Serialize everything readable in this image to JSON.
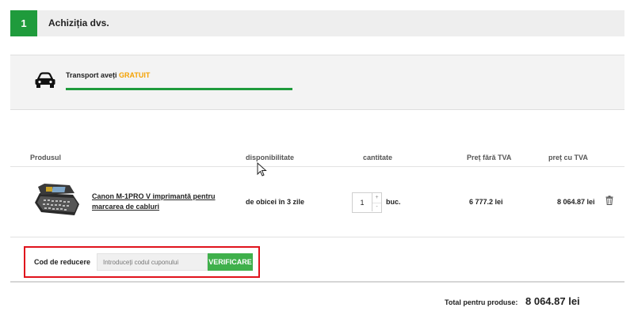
{
  "step": {
    "number": "1",
    "title": "Achiziția dvs."
  },
  "transport": {
    "text": "Transport aveți",
    "highlight": "GRATUIT",
    "progress": 1.0,
    "icon": "car-icon"
  },
  "table": {
    "headers": {
      "product": "Produsul",
      "availability": "disponibilitate",
      "quantity": "cantitate",
      "price_net": "Preț fără TVA",
      "price_gross": "preț cu TVA"
    },
    "rows": [
      {
        "name": "Canon M-1PRO V imprimantă pentru marcarea de cabluri",
        "availability": "de obicei în 3 zile",
        "quantity": "1",
        "unit": "buc.",
        "price_net": "6 777.2 lei",
        "price_gross": "8 064.87 lei"
      }
    ]
  },
  "qty_controls": {
    "plus": "+",
    "minus": "-"
  },
  "coupon": {
    "label": "Cod de reducere",
    "placeholder": "Introduceți codul cuponului",
    "button": "VERIFICARE"
  },
  "total": {
    "label": "Total pentru produse:",
    "value": "8 064.87 lei"
  },
  "colors": {
    "accent_green": "#1f9b3c",
    "button_green": "#3fb04b",
    "highlight_orange": "#f4a100",
    "outline_red": "#e0131c"
  }
}
